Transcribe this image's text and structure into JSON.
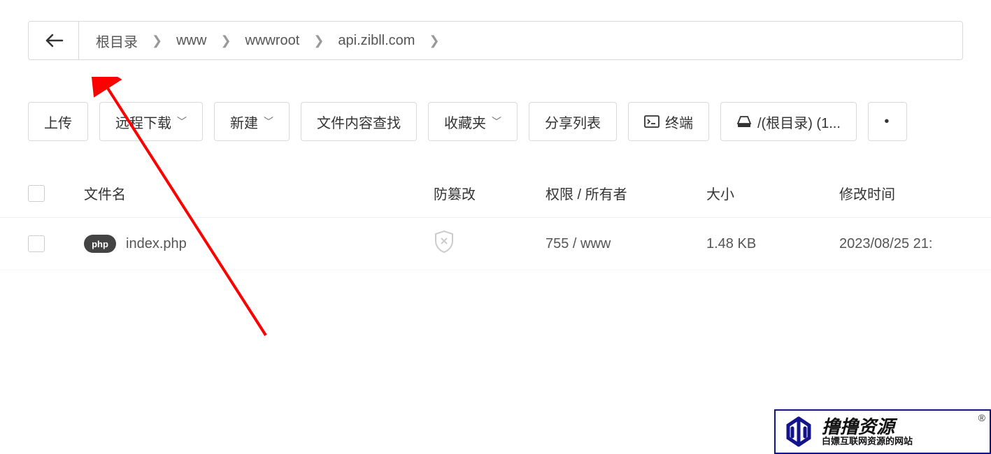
{
  "breadcrumb": {
    "items": [
      "根目录",
      "www",
      "wwwroot",
      "api.zibll.com"
    ]
  },
  "toolbar": {
    "upload": "上传",
    "remote_download": "远程下载",
    "new": "新建",
    "content_search": "文件内容查找",
    "favorites": "收藏夹",
    "share_list": "分享列表",
    "terminal": "终端",
    "disk": "/(根目录) (1..."
  },
  "table": {
    "headers": {
      "name": "文件名",
      "tamper": "防篡改",
      "perm": "权限 / 所有者",
      "size": "大小",
      "mtime": "修改时间"
    },
    "rows": [
      {
        "icon_label": "php",
        "name": "index.php",
        "perm": "755 / www",
        "size": "1.48 KB",
        "mtime": "2023/08/25 21:"
      }
    ]
  },
  "watermark": {
    "main": "撸撸资源",
    "sub": "白嫖互联网资源的网站",
    "mark": "®"
  }
}
